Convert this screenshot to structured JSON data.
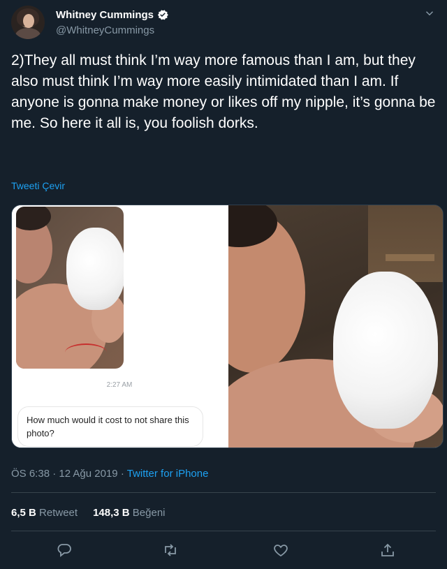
{
  "author": {
    "name": "Whitney Cummings",
    "handle": "@WhitneyCummings",
    "verified": true
  },
  "tweet": {
    "text": "2)They all must think I’m way more famous than I am, but they also must think I’m way more easily intimidated than I am. If anyone is gonna make money or likes off my nipple, it’s gonna be me. So here it all is, you foolish dorks.",
    "translate_label": "Tweeti Çevir"
  },
  "media": {
    "message_time": "2:27 AM",
    "message_text": "How much would it cost to not share this photo?"
  },
  "meta": {
    "time": "ÖS 6:38",
    "sep1": " · ",
    "date": "12 Ağu 2019",
    "sep2": " · ",
    "source": "Twitter for iPhone"
  },
  "stats": {
    "retweets_count": "6,5 B",
    "retweets_label": "Retweet",
    "likes_count": "148,3 B",
    "likes_label": "Beğeni"
  },
  "icons": {
    "reply": "reply-icon",
    "retweet": "retweet-icon",
    "like": "heart-icon",
    "share": "share-icon",
    "more": "chevron-down-icon",
    "verified": "verified-badge-icon"
  },
  "colors": {
    "background": "#15202b",
    "accent": "#1da1f2",
    "secondary_text": "#8899a6",
    "divider": "#38444d"
  }
}
